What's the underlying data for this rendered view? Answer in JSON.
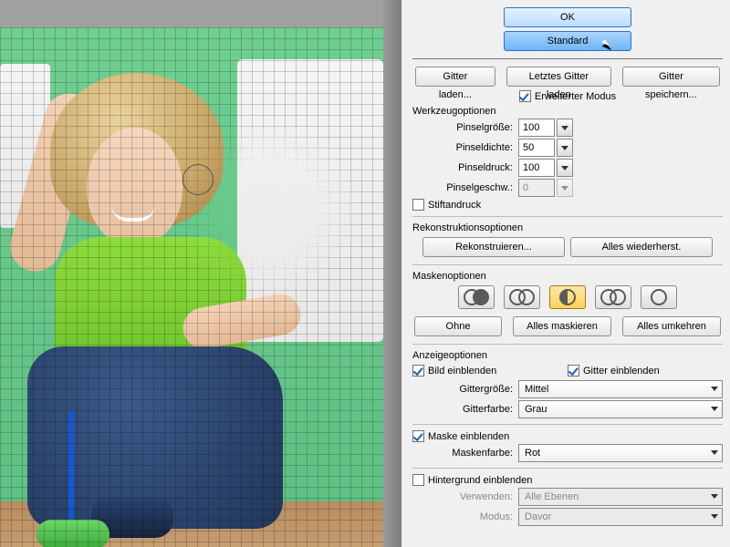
{
  "top": {
    "ok": "OK",
    "standard": "Standard"
  },
  "gridButtons": {
    "load": "Gitter laden...",
    "loadLast": "Letztes Gitter laden",
    "save": "Gitter speichern..."
  },
  "advanced": {
    "label": "Erweiterter Modus",
    "checked": true
  },
  "tool": {
    "title": "Werkzeugoptionen",
    "brushSize": {
      "label": "Pinselgröße:",
      "value": "100"
    },
    "brushDensity": {
      "label": "Pinseldichte:",
      "value": "50"
    },
    "brushPress": {
      "label": "Pinseldruck:",
      "value": "100"
    },
    "brushRate": {
      "label": "Pinselgeschw.:",
      "value": "0"
    },
    "stylus": {
      "label": "Stiftandruck",
      "checked": false
    }
  },
  "reconstruct": {
    "title": "Rekonstruktionsoptionen",
    "reconstruct": "Rekonstruieren...",
    "restoreAll": "Alles wiederherst."
  },
  "mask": {
    "title": "Maskenoptionen",
    "none": "Ohne",
    "maskAll": "Alles maskieren",
    "invertAll": "Alles umkehren"
  },
  "view": {
    "title": "Anzeigeoptionen",
    "showImage": {
      "label": "Bild einblenden",
      "checked": true
    },
    "showGrid": {
      "label": "Gitter einblenden",
      "checked": true
    },
    "gridSize": {
      "label": "Gittergröße:",
      "value": "Mittel"
    },
    "gridColor": {
      "label": "Gitterfarbe:",
      "value": "Grau"
    },
    "showMask": {
      "label": "Maske einblenden",
      "checked": true
    },
    "maskColor": {
      "label": "Maskenfarbe:",
      "value": "Rot"
    },
    "showBackdrop": {
      "label": "Hintergrund einblenden",
      "checked": false
    },
    "use": {
      "label": "Verwenden:",
      "value": "Alle Ebenen"
    },
    "mode": {
      "label": "Modus:",
      "value": "Davor"
    }
  }
}
